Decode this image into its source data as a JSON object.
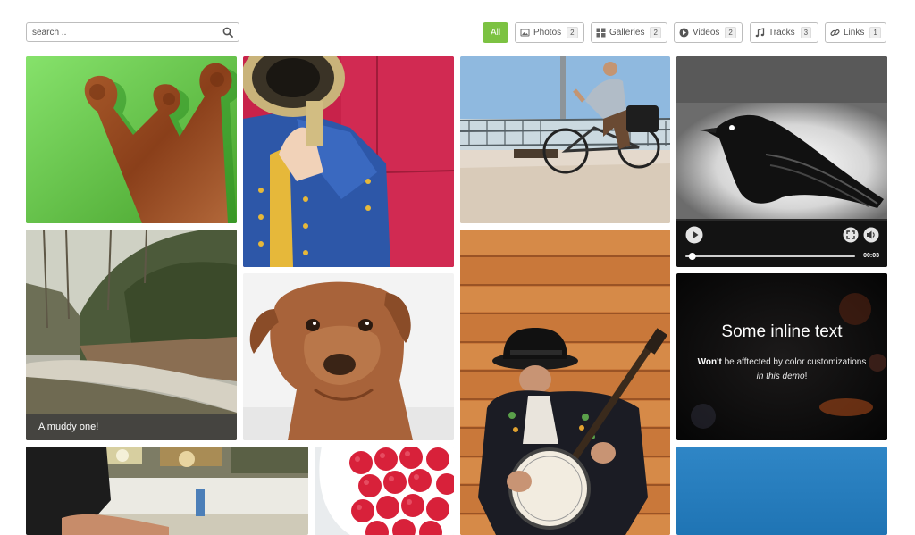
{
  "search": {
    "placeholder": "search .."
  },
  "filters": [
    {
      "label": "All"
    },
    {
      "label": "Photos",
      "count": "2",
      "icon": "image-icon"
    },
    {
      "label": "Galleries",
      "count": "2",
      "icon": "grid-icon"
    },
    {
      "label": "Videos",
      "count": "2",
      "icon": "play-circle-icon"
    },
    {
      "label": "Tracks",
      "count": "3",
      "icon": "music-note-icon"
    },
    {
      "label": "Links",
      "count": "1",
      "icon": "link-icon"
    }
  ],
  "accent_color": "#7cc242",
  "tiles": {
    "road_caption": "A muddy one!",
    "video_time": "00:03",
    "video_progress": 0.02,
    "inline": {
      "title": "Some inline text",
      "line1_bold": "Won't",
      "line1_rest": " be afftected by color customizations",
      "line2_italic": "in this demo",
      "line2_rest": "!"
    }
  }
}
